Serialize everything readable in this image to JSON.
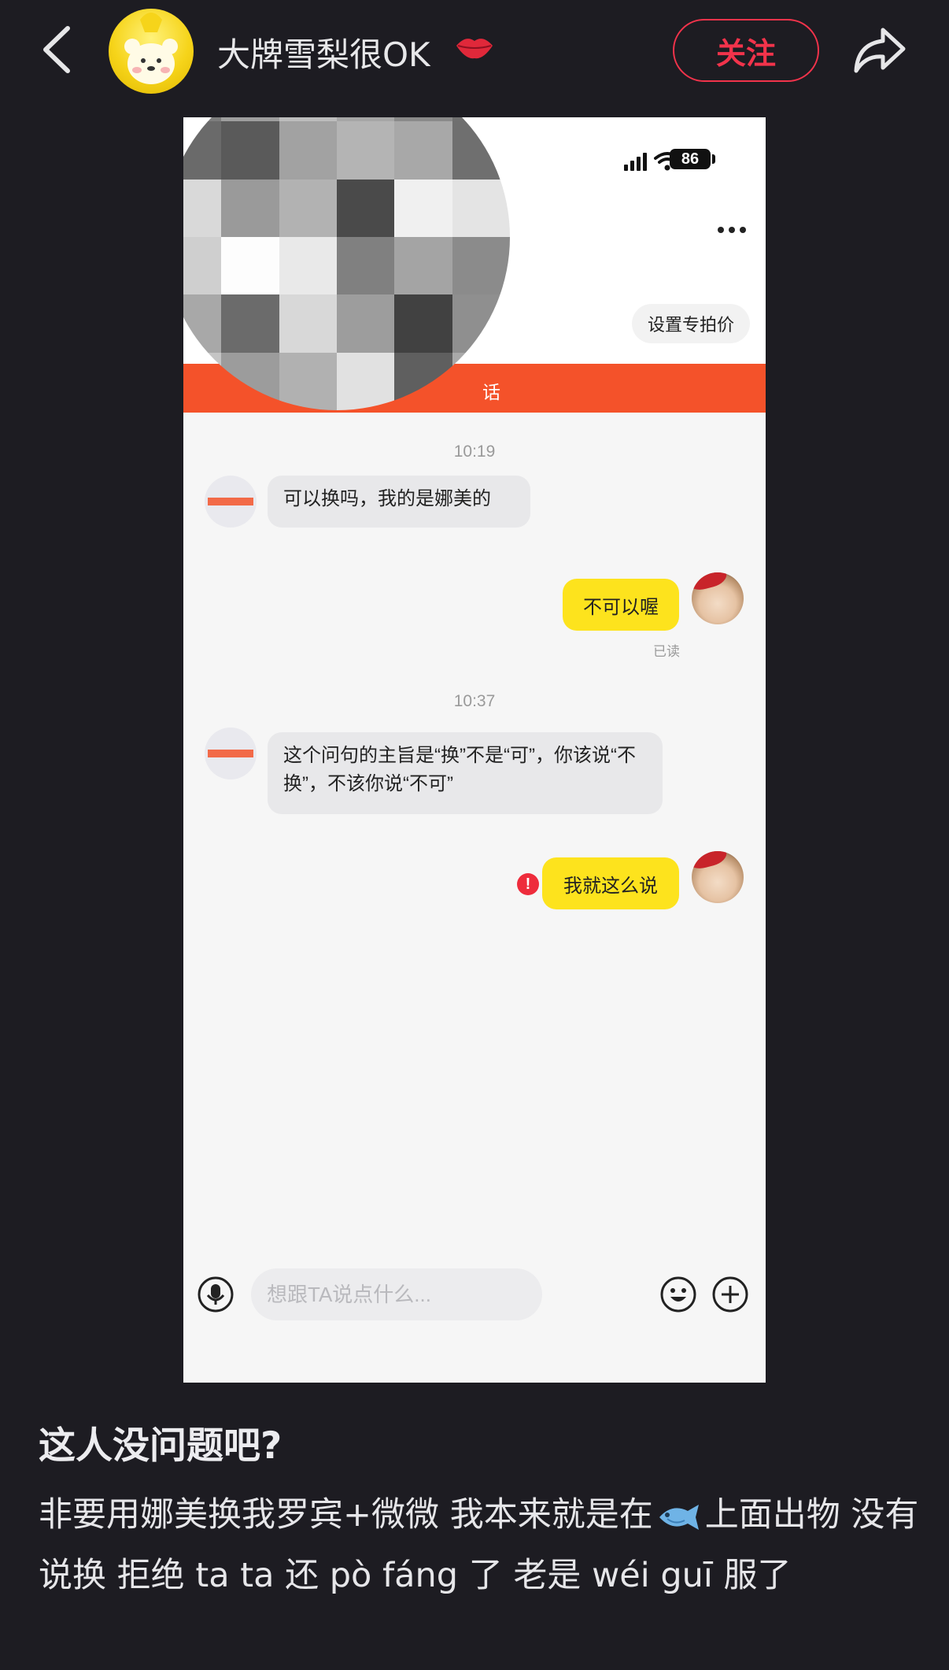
{
  "header": {
    "author_name": "大牌雪梨很OK",
    "follow_label": "关注"
  },
  "chat": {
    "battery": "86",
    "price_button": "设置专拍价",
    "banner_text": "话",
    "messages": [
      {
        "time": "10:19"
      },
      {
        "from": "other",
        "text": "可以换吗，我的是娜美的"
      },
      {
        "from": "me",
        "text": "不可以喔",
        "status": "已读"
      },
      {
        "time": "10:37"
      },
      {
        "from": "other",
        "text": "这个问句的主旨是“换”不是“可”，你该说“不换”，不该你说“不可”"
      },
      {
        "from": "me",
        "text": "我就这么说",
        "failed": true
      }
    ],
    "input_placeholder": "想跟TA说点什么..."
  },
  "post": {
    "title": "这人没问题吧?",
    "body_part1": "非要用娜美换我罗宾+微微 我本来就是在",
    "body_part2": "上面出物 没有说换 拒绝 ta ta 还 pò fáng 了 老是 wéi guī 服了"
  },
  "colors": {
    "background": "#1d1c22",
    "follow_red": "#f2334b",
    "banner_orange": "#f4522a",
    "bubble_yellow": "#fde31d",
    "error_red": "#ee2c3c"
  }
}
